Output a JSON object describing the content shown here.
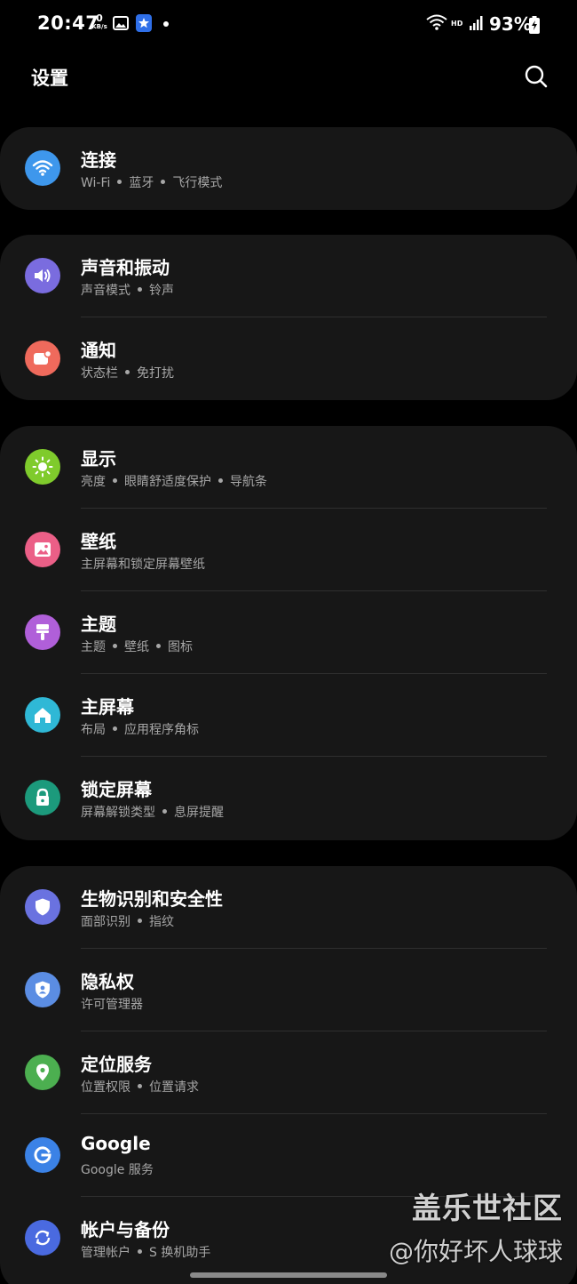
{
  "status_bar": {
    "time": "20:47",
    "net_speed_value": "0",
    "net_speed_unit": "KB/s",
    "network_type": "HD",
    "battery_percent": "93%"
  },
  "header": {
    "title": "设置",
    "search_icon": "search-icon"
  },
  "groups": [
    {
      "items": [
        {
          "id": "connections",
          "title": "连接",
          "subtitle": [
            "Wi-Fi",
            "蓝牙",
            "飞行模式"
          ],
          "icon": "wifi-icon",
          "color": "#3e97ec"
        }
      ]
    },
    {
      "items": [
        {
          "id": "sounds",
          "title": "声音和振动",
          "subtitle": [
            "声音模式",
            "铃声"
          ],
          "icon": "speaker-icon",
          "color": "#7a6cdf"
        },
        {
          "id": "notifications",
          "title": "通知",
          "subtitle": [
            "状态栏",
            "免打扰"
          ],
          "icon": "notification-icon",
          "color": "#ef6a5c"
        }
      ]
    },
    {
      "items": [
        {
          "id": "display",
          "title": "显示",
          "subtitle": [
            "亮度",
            "眼睛舒适度保护",
            "导航条"
          ],
          "icon": "sun-icon",
          "color": "#7fcb2c"
        },
        {
          "id": "wallpaper",
          "title": "壁纸",
          "subtitle": [
            "主屏幕和锁定屏幕壁纸"
          ],
          "icon": "picture-icon",
          "color": "#eb5f87"
        },
        {
          "id": "themes",
          "title": "主题",
          "subtitle": [
            "主题",
            "壁纸",
            "图标"
          ],
          "icon": "paintbrush-icon",
          "color": "#b05fd9"
        },
        {
          "id": "home_screen",
          "title": "主屏幕",
          "subtitle": [
            "布局",
            "应用程序角标"
          ],
          "icon": "home-icon",
          "color": "#2fb8d6"
        },
        {
          "id": "lock_screen",
          "title": "锁定屏幕",
          "subtitle": [
            "屏幕解锁类型",
            "息屏提醒"
          ],
          "icon": "lock-icon",
          "color": "#1c9a7c"
        }
      ]
    },
    {
      "items": [
        {
          "id": "biometrics",
          "title": "生物识别和安全性",
          "subtitle": [
            "面部识别",
            "指纹"
          ],
          "icon": "shield-icon",
          "color": "#6a72e0"
        },
        {
          "id": "privacy",
          "title": "隐私权",
          "subtitle": [
            "许可管理器"
          ],
          "icon": "privacy-shield-icon",
          "color": "#5b8de3"
        },
        {
          "id": "location",
          "title": "定位服务",
          "subtitle": [
            "位置权限",
            "位置请求"
          ],
          "icon": "location-pin-icon",
          "color": "#4caf50"
        },
        {
          "id": "google",
          "title": "Google",
          "subtitle": [
            "Google 服务"
          ],
          "icon": "google-icon",
          "color": "#3b82e6"
        },
        {
          "id": "accounts",
          "title": "帐户与备份",
          "subtitle": [
            "管理帐户",
            "S 换机助手"
          ],
          "icon": "sync-icon",
          "color": "#4a6ae0"
        }
      ]
    }
  ],
  "watermark": {
    "title": "盖乐世社区",
    "subtitle": "@你好坏人球球"
  }
}
